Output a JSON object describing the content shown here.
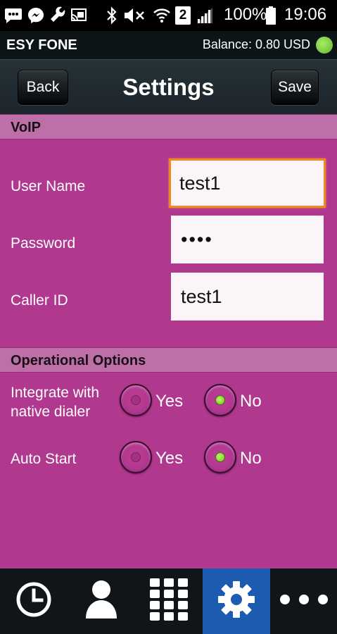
{
  "status_bar": {
    "battery": "100%",
    "time": "19:06",
    "sim_slot": "2",
    "icons": [
      "message-icon",
      "messenger-icon",
      "wrench-icon",
      "cast-icon",
      "bluetooth-icon",
      "mute-icon",
      "wifi-icon",
      "sim-icon",
      "signal-icon",
      "battery-icon"
    ]
  },
  "app_bar": {
    "app_name": "ESY FONE",
    "balance": "Balance: 0.80 USD",
    "status_color": "#7ed13d"
  },
  "title_bar": {
    "back_label": "Back",
    "title": "Settings",
    "save_label": "Save"
  },
  "voip": {
    "section_title": "VoIP",
    "user_name_label": "User Name",
    "user_name_value": "test1",
    "password_label": "Password",
    "password_value": "••••",
    "caller_id_label": "Caller ID",
    "caller_id_value": "test1"
  },
  "options": {
    "section_title": "Operational Options",
    "integrate_label_line1": "Integrate with",
    "integrate_label_line2": "native dialer",
    "integrate_selected": "No",
    "auto_start_label": "Auto Start",
    "auto_start_selected": "No",
    "yes_label": "Yes",
    "no_label": "No"
  },
  "bottom_nav": {
    "items": [
      "history-icon",
      "contacts-icon",
      "dialpad-icon",
      "settings-icon",
      "more-icon"
    ],
    "active": "settings-icon"
  },
  "colors": {
    "background": "#b0388f",
    "section_header": "#bf6fa7",
    "focus": "#f08a20",
    "nav_active": "#1b5bb0"
  }
}
